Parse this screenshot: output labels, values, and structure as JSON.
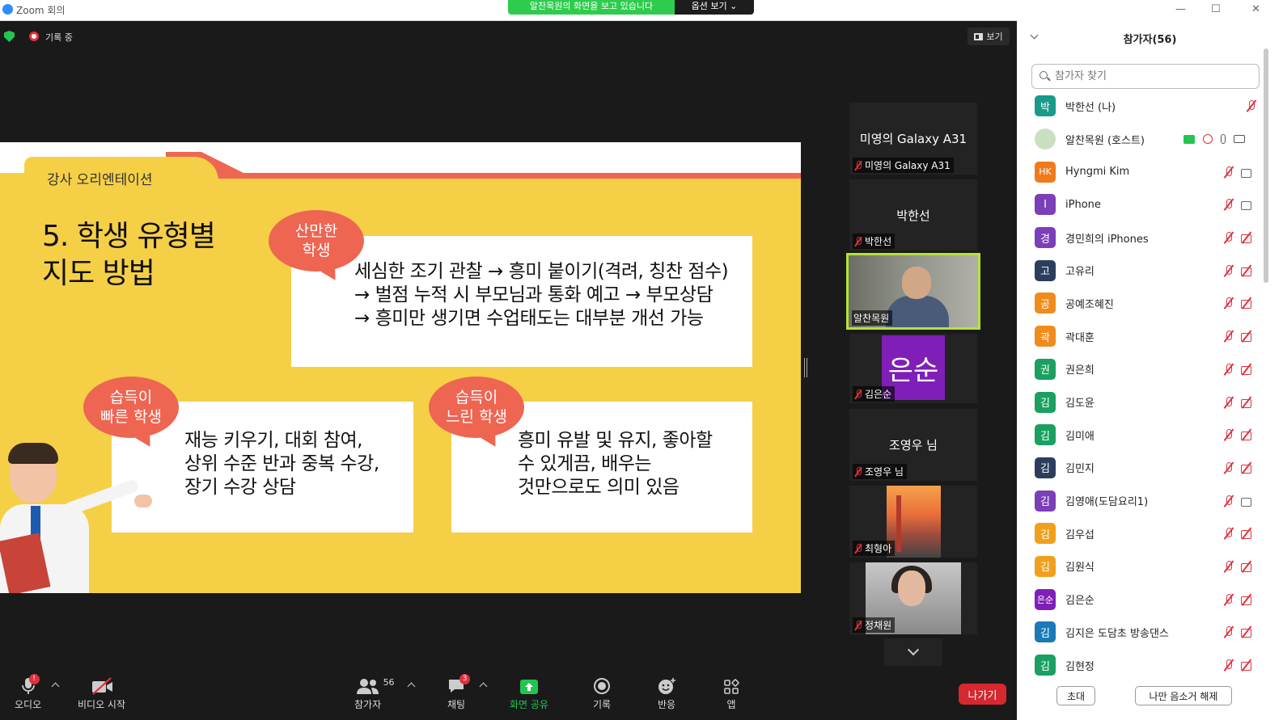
{
  "window": {
    "title": "Zoom 회의",
    "minimize": "—",
    "maximize": "☐",
    "close": "✕"
  },
  "share_banner": {
    "message": "알찬목원의 화면을 보고 있습니다",
    "options": "옵션 보기 ⌄"
  },
  "status": {
    "recording": "기록 중",
    "view": "보기"
  },
  "slide": {
    "tab": "강사 오리엔테이션",
    "title": "5. 학생 유형별\n지도 방법",
    "bubble1": "산만한\n학생",
    "box1": "세심한 조기 관찰 → 흥미 붙이기(격려, 칭찬 점수)\n→ 벌점 누적 시 부모님과 통화 예고 → 부모상담\n→ 흥미만 생기면 수업태도는 대부분 개선 가능",
    "bubble2": "습득이\n빠른 학생",
    "box2": "재능 키우기, 대회 참여,\n상위 수준 반과 중복 수강,\n장기 수강 상담",
    "bubble3": "습득이\n느린 학생",
    "box3": "흥미 유발 및 유지, 좋아할\n수 있게끔, 배우는\n것만으로도 의미 있음"
  },
  "video_tiles": [
    {
      "name": "미영의 Galaxy A31",
      "label": "미영의 Galaxy A31"
    },
    {
      "name": "박한선",
      "label": "박한선"
    },
    {
      "name": "",
      "label": "알찬목원"
    },
    {
      "avatar": "은순",
      "label": "김은순"
    },
    {
      "name": "조영우 님",
      "label": "조영우 님"
    },
    {
      "name": "",
      "label": "최형아"
    },
    {
      "name": "",
      "label": "정채원"
    }
  ],
  "toolbar": {
    "audio": "오디오",
    "video": "비디오 시작",
    "participants": "참가자",
    "participants_count": "56",
    "chat": "채팅",
    "chat_badge": "3",
    "share": "화면 공유",
    "record": "기록",
    "reactions": "반응",
    "apps": "앱",
    "leave": "나가기"
  },
  "participants_panel": {
    "title": "참가자(56)",
    "search_placeholder": "참가자 찾기",
    "invite": "초대",
    "unmute_me": "나만 음소거 해제",
    "list": [
      {
        "avatar": "박",
        "color": "#1a9a8a",
        "name": "박한선 (나)"
      },
      {
        "avatar": "",
        "color": "#c9e0c0",
        "name": "알찬목원 (호스트)"
      },
      {
        "avatar": "HK",
        "color": "#f07b1d",
        "name": "Hyngmi Kim"
      },
      {
        "avatar": "I",
        "color": "#7b3fb8",
        "name": "iPhone"
      },
      {
        "avatar": "경",
        "color": "#7b3fb8",
        "name": "경민희의 iPhones"
      },
      {
        "avatar": "고",
        "color": "#2c3e5c",
        "name": "고유리"
      },
      {
        "avatar": "공",
        "color": "#f08c1d",
        "name": "공예조혜진"
      },
      {
        "avatar": "곽",
        "color": "#f08c1d",
        "name": "곽대훈"
      },
      {
        "avatar": "권",
        "color": "#1aa060",
        "name": "권은희"
      },
      {
        "avatar": "김",
        "color": "#1aa060",
        "name": "김도윤"
      },
      {
        "avatar": "김",
        "color": "#1aa060",
        "name": "김미애"
      },
      {
        "avatar": "김",
        "color": "#2c3e5c",
        "name": "김민지"
      },
      {
        "avatar": "김",
        "color": "#7b3fb8",
        "name": "김영애(도담요리1)"
      },
      {
        "avatar": "김",
        "color": "#f0a01d",
        "name": "김우섭"
      },
      {
        "avatar": "김",
        "color": "#f0a01d",
        "name": "김원식"
      },
      {
        "avatar": "은순",
        "color": "#7f1fb8",
        "name": "김은순"
      },
      {
        "avatar": "김",
        "color": "#1a7ab8",
        "name": "김지은 도담초 방송댄스"
      },
      {
        "avatar": "김",
        "color": "#1aa060",
        "name": "김현정"
      }
    ]
  }
}
